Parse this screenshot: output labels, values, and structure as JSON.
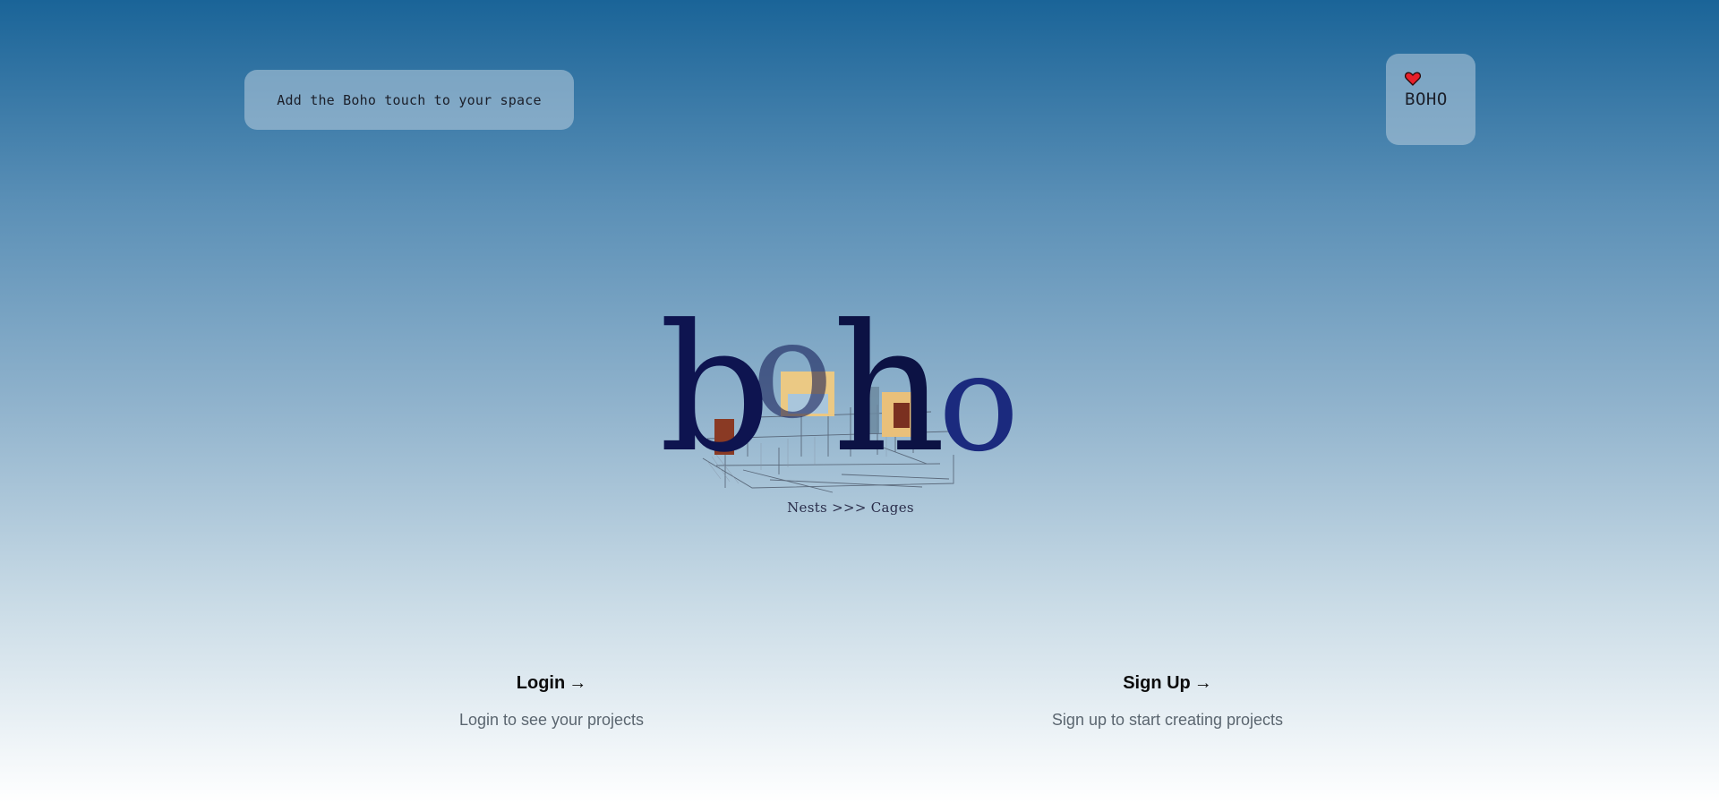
{
  "header": {
    "tagline": "Add the Boho touch to your space",
    "brand_badge_label": "BOHO",
    "brand_badge_icon": "heart-icon"
  },
  "logo": {
    "wordmark": "boho",
    "subtitle": "Nests >>> Cages"
  },
  "actions": {
    "login": {
      "label": "Login",
      "arrow": "→",
      "description": "Login to see your projects"
    },
    "signup": {
      "label": "Sign Up",
      "arrow": "→",
      "description": "Sign up to start creating projects"
    }
  },
  "colors": {
    "gradient_top": "#1a6498",
    "gradient_bottom": "#ffffff",
    "logo_navy": "#0e1450",
    "logo_blue": "#1b2a7e",
    "heart_red": "#e8202a"
  }
}
